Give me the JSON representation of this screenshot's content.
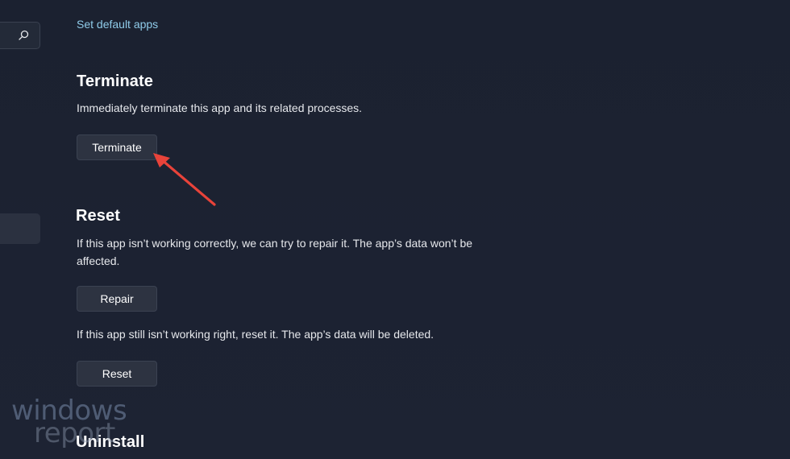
{
  "sidebar": {
    "search_icon": "search-icon"
  },
  "links": {
    "set_default_apps": "Set default apps"
  },
  "terminate": {
    "heading": "Terminate",
    "description": "Immediately terminate this app and its related processes.",
    "button_label": "Terminate"
  },
  "reset": {
    "heading": "Reset",
    "repair_description": "If this app isn’t working correctly, we can try to repair it. The app’s data won’t be affected.",
    "repair_button_label": "Repair",
    "reset_description": "If this app still isn’t working right, reset it. The app’s data will be deleted.",
    "reset_button_label": "Reset"
  },
  "uninstall": {
    "heading": "Uninstall"
  },
  "annotation": {
    "arrow_color": "#e8433a"
  },
  "watermark": {
    "line1": "windows",
    "line2": "report"
  },
  "colors": {
    "background": "#1c2230",
    "link": "#8fcbe9",
    "button_bg": "#2d3341"
  }
}
